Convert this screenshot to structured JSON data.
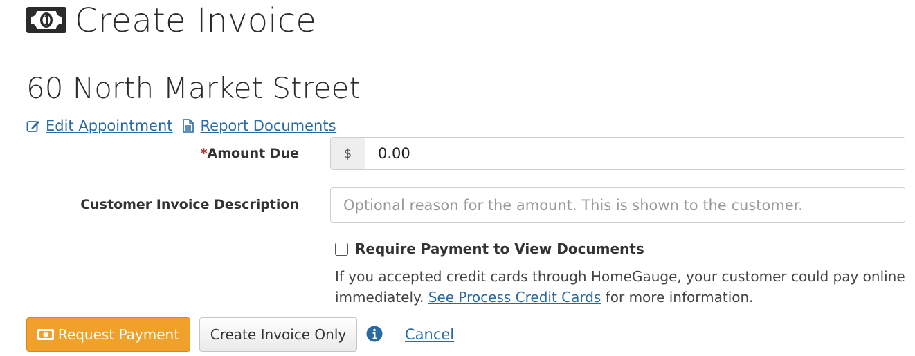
{
  "header": {
    "icon": "money-bill-icon",
    "title": "Create Invoice"
  },
  "appointment": {
    "address": "60 North Market Street",
    "links": [
      {
        "icon": "edit-icon",
        "label": "Edit Appointment"
      },
      {
        "icon": "document-icon",
        "label": "Report Documents"
      }
    ]
  },
  "form": {
    "amount": {
      "required_mark": "*",
      "label": "Amount Due",
      "currency_symbol": "$",
      "value": "0.00"
    },
    "description": {
      "label": "Customer Invoice Description",
      "value": "",
      "placeholder": "Optional reason for the amount. This is shown to the customer."
    },
    "require_payment": {
      "checked": false,
      "label": "Require Payment to View Documents"
    },
    "help": {
      "text_before": "If you accepted credit cards through HomeGauge, your customer could pay online immediately. ",
      "link_label": "See Process Credit Cards",
      "text_after": " for more information."
    }
  },
  "actions": {
    "request_payment_label": "Request Payment",
    "create_invoice_only_label": "Create Invoice Only",
    "info_icon": "info-circle-icon",
    "cancel_label": "Cancel"
  },
  "colors": {
    "accent_orange": "#f0a12b",
    "link_blue": "#2a6aa3",
    "required_red": "#b33a3a",
    "info_blue": "#2a6aa3"
  }
}
